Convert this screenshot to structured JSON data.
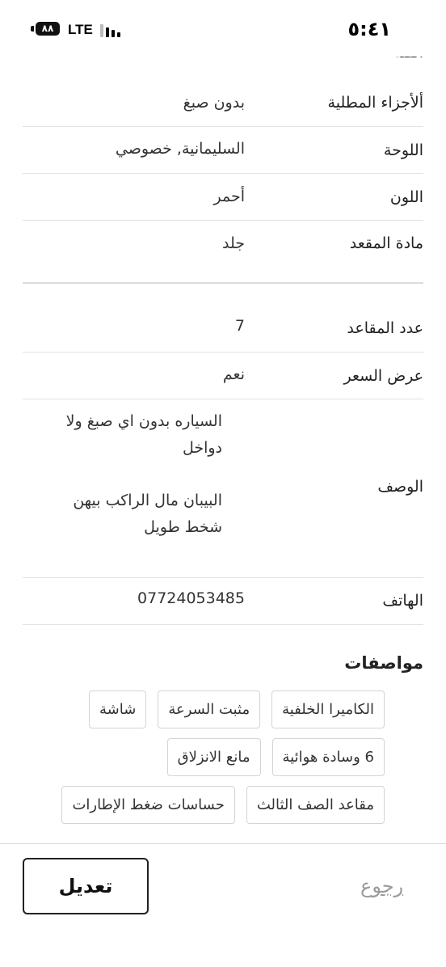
{
  "status_bar": {
    "time": "٥:٤١",
    "network": "LTE",
    "battery": "٨٨"
  },
  "details": {
    "partial_label": "الفئة",
    "rows": [
      {
        "label": "ألأجزاء المطلية",
        "value": "بدون صبغ"
      },
      {
        "label": "اللوحة",
        "value": "السليمانية, خصوصي"
      },
      {
        "label": "اللون",
        "value": "أحمر"
      },
      {
        "label": "مادة المقعد",
        "value": "جلد"
      },
      {
        "label": "عدد المقاعد",
        "value": "7"
      },
      {
        "label": "عرض السعر",
        "value": "نعم"
      }
    ],
    "description": {
      "label": "الوصف",
      "paragraphs": [
        "السياره بدون اي صبغ ولا دواخل",
        "البيبان مال الراكب بيهن شخط طويل"
      ]
    },
    "phone": {
      "label": "الهاتف",
      "value": "07724053485"
    }
  },
  "features": {
    "title": "مواصفات",
    "rows": [
      [
        "الكاميرا الخلفية",
        "مثبت السرعة",
        "شاشة"
      ],
      [
        "6 وسادة هوائية",
        "مانع الانزلاق"
      ],
      [
        "مقاعد الصف الثالث",
        "حساسات ضغط الإطارات"
      ]
    ]
  },
  "actions": {
    "back_label": "رجوع",
    "edit_label": "تعديل"
  }
}
